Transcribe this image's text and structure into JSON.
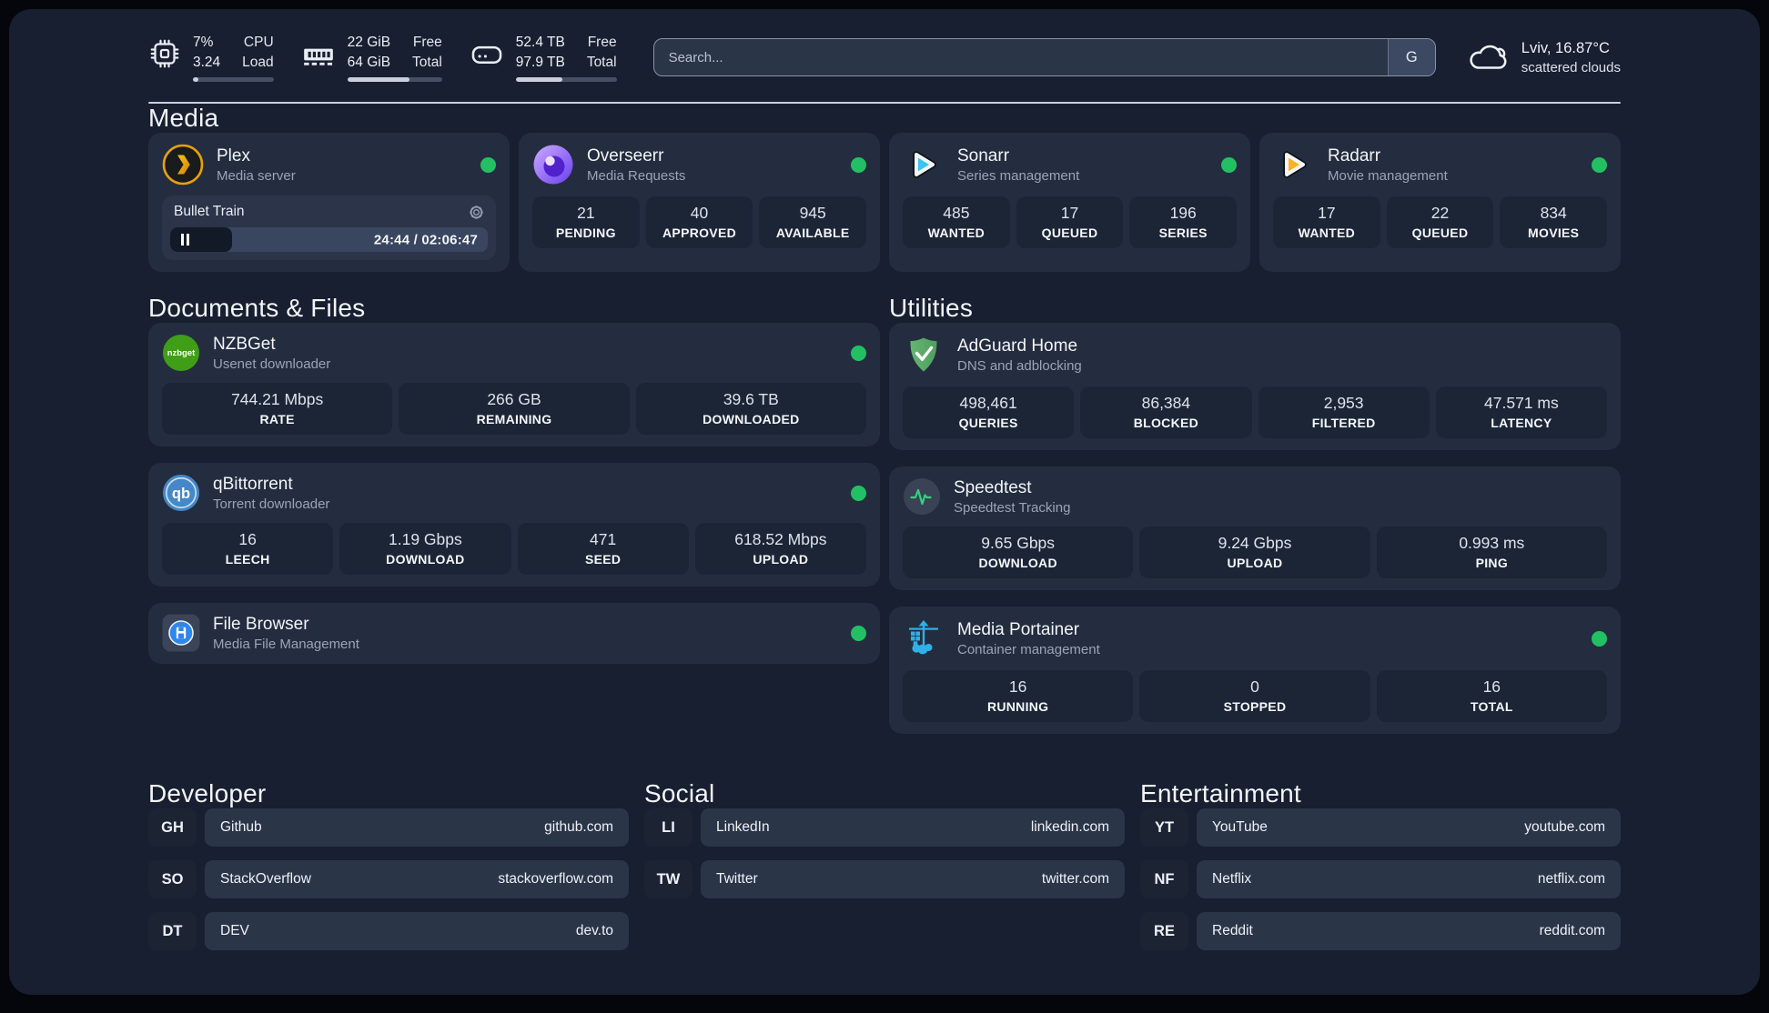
{
  "theme": {
    "status_green": "#22c063",
    "progress_fill": "#c9d0dc",
    "background": "#171f30",
    "card": "#242d3f",
    "tile": "#1c2536"
  },
  "topbar": {
    "metrics": [
      {
        "icon": "cpu-icon",
        "value_top": "7%",
        "label_top": "CPU",
        "value_bottom": "3.24",
        "label_bottom": "Load",
        "progress_pct": 7
      },
      {
        "icon": "memory-icon",
        "value_top": "22 GiB",
        "label_top": "Free",
        "value_bottom": "64 GiB",
        "label_bottom": "Total",
        "progress_pct": 66
      },
      {
        "icon": "disk-icon",
        "value_top": "52.4 TB",
        "label_top": "Free",
        "value_bottom": "97.9 TB",
        "label_bottom": "Total",
        "progress_pct": 46
      }
    ],
    "search": {
      "placeholder": "Search...",
      "provider_button": "G"
    },
    "weather": {
      "location_temp": "Lviv, 16.87°C",
      "condition": "scattered clouds"
    }
  },
  "sections": {
    "media": {
      "title": "Media",
      "cards": {
        "plex": {
          "title": "Plex",
          "subtitle": "Media server",
          "online": true,
          "now_playing": {
            "title": "Bullet Train",
            "time_display": "24:44 / 02:06:47",
            "progress_pct": 19.5,
            "state": "paused"
          }
        },
        "overseerr": {
          "title": "Overseerr",
          "subtitle": "Media Requests",
          "online": true,
          "stats": [
            {
              "value": "21",
              "label": "PENDING"
            },
            {
              "value": "40",
              "label": "APPROVED"
            },
            {
              "value": "945",
              "label": "AVAILABLE"
            }
          ]
        },
        "sonarr": {
          "title": "Sonarr",
          "subtitle": "Series management",
          "online": true,
          "stats": [
            {
              "value": "485",
              "label": "WANTED"
            },
            {
              "value": "17",
              "label": "QUEUED"
            },
            {
              "value": "196",
              "label": "SERIES"
            }
          ]
        },
        "radarr": {
          "title": "Radarr",
          "subtitle": "Movie management",
          "online": true,
          "stats": [
            {
              "value": "17",
              "label": "WANTED"
            },
            {
              "value": "22",
              "label": "QUEUED"
            },
            {
              "value": "834",
              "label": "MOVIES"
            }
          ]
        }
      }
    },
    "documents": {
      "title": "Documents & Files",
      "cards": {
        "nzbget": {
          "title": "NZBGet",
          "subtitle": "Usenet downloader",
          "online": true,
          "icon_text": "nzbget",
          "stats": [
            {
              "value": "744.21 Mbps",
              "label": "RATE"
            },
            {
              "value": "266 GB",
              "label": "REMAINING"
            },
            {
              "value": "39.6 TB",
              "label": "DOWNLOADED"
            }
          ]
        },
        "qbittorrent": {
          "title": "qBittorrent",
          "subtitle": "Torrent downloader",
          "online": true,
          "icon_text": "qb",
          "stats": [
            {
              "value": "16",
              "label": "LEECH"
            },
            {
              "value": "1.19 Gbps",
              "label": "DOWNLOAD"
            },
            {
              "value": "471",
              "label": "SEED"
            },
            {
              "value": "618.52 Mbps",
              "label": "UPLOAD"
            }
          ]
        },
        "filebrowser": {
          "title": "File Browser",
          "subtitle": "Media File Management",
          "online": true
        }
      }
    },
    "utilities": {
      "title": "Utilities",
      "cards": {
        "adguard": {
          "title": "AdGuard Home",
          "subtitle": "DNS and adblocking",
          "online": false,
          "stats": [
            {
              "value": "498,461",
              "label": "QUERIES"
            },
            {
              "value": "86,384",
              "label": "BLOCKED"
            },
            {
              "value": "2,953",
              "label": "FILTERED"
            },
            {
              "value": "47.571 ms",
              "label": "LATENCY"
            }
          ]
        },
        "speedtest": {
          "title": "Speedtest",
          "subtitle": "Speedtest Tracking",
          "online": false,
          "stats": [
            {
              "value": "9.65 Gbps",
              "label": "DOWNLOAD"
            },
            {
              "value": "9.24 Gbps",
              "label": "UPLOAD"
            },
            {
              "value": "0.993 ms",
              "label": "PING"
            }
          ]
        },
        "portainer": {
          "title": "Media Portainer",
          "subtitle": "Container management",
          "online": true,
          "stats": [
            {
              "value": "16",
              "label": "RUNNING"
            },
            {
              "value": "0",
              "label": "STOPPED"
            },
            {
              "value": "16",
              "label": "TOTAL"
            }
          ]
        }
      }
    }
  },
  "bookmarks": [
    {
      "title": "Developer",
      "items": [
        {
          "abbr": "GH",
          "name": "Github",
          "domain": "github.com"
        },
        {
          "abbr": "SO",
          "name": "StackOverflow",
          "domain": "stackoverflow.com"
        },
        {
          "abbr": "DT",
          "name": "DEV",
          "domain": "dev.to"
        }
      ]
    },
    {
      "title": "Social",
      "items": [
        {
          "abbr": "LI",
          "name": "LinkedIn",
          "domain": "linkedin.com"
        },
        {
          "abbr": "TW",
          "name": "Twitter",
          "domain": "twitter.com"
        }
      ]
    },
    {
      "title": "Entertainment",
      "items": [
        {
          "abbr": "YT",
          "name": "YouTube",
          "domain": "youtube.com"
        },
        {
          "abbr": "NF",
          "name": "Netflix",
          "domain": "netflix.com"
        },
        {
          "abbr": "RE",
          "name": "Reddit",
          "domain": "reddit.com"
        }
      ]
    }
  ]
}
